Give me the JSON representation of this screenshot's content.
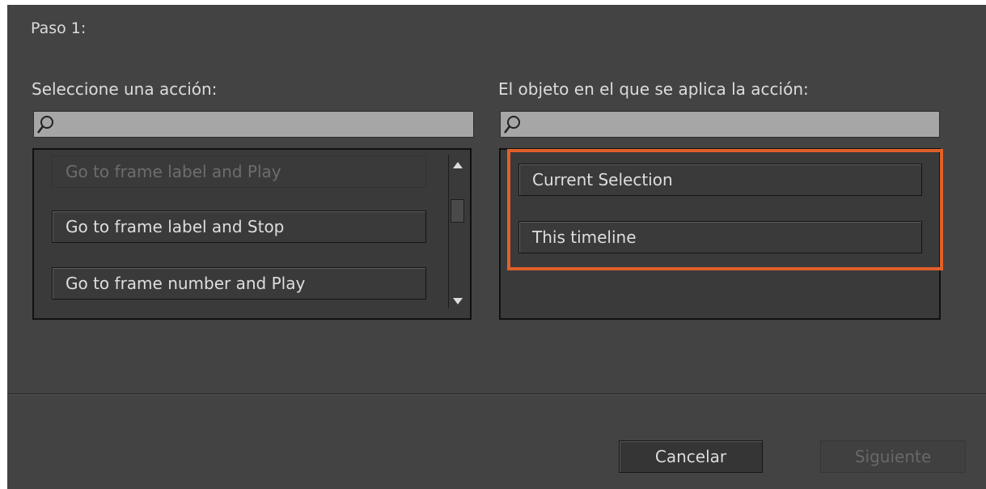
{
  "step": {
    "label": "Paso 1:"
  },
  "actions": {
    "label": "Seleccione una acción:",
    "search": {
      "value": "",
      "icon": "search-icon"
    },
    "items": [
      {
        "label": "Go to frame label and Play",
        "enabled": false
      },
      {
        "label": "Go to frame label and Stop",
        "enabled": true
      },
      {
        "label": "Go to frame number and Play",
        "enabled": true
      }
    ]
  },
  "targets": {
    "label": "El objeto en el que se aplica la acción:",
    "search": {
      "value": "",
      "icon": "search-icon"
    },
    "items": [
      {
        "label": "Current Selection"
      },
      {
        "label": "This timeline"
      }
    ]
  },
  "footer": {
    "cancel_label": "Cancelar",
    "next_label": "Siguiente",
    "next_enabled": false
  },
  "colors": {
    "dialog_bg": "#434343",
    "highlight": "#e0602a",
    "search_bg": "#a6a6a6"
  }
}
